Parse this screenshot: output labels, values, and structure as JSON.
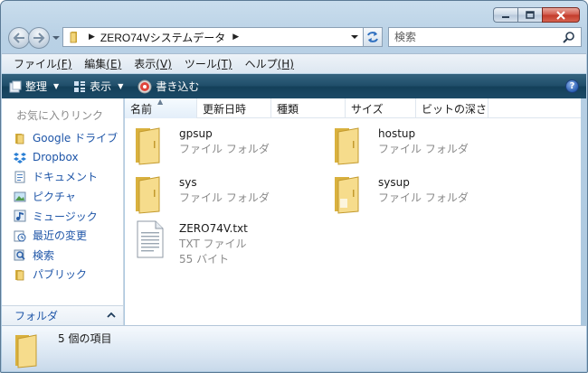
{
  "address": {
    "path": "ZERO74Vシステムデータ"
  },
  "search": {
    "placeholder": "検索"
  },
  "menu": [
    {
      "label": "ファイル",
      "key": "(F)"
    },
    {
      "label": "編集",
      "key": "(E)"
    },
    {
      "label": "表示",
      "key": "(V)"
    },
    {
      "label": "ツール",
      "key": "(T)"
    },
    {
      "label": "ヘルプ",
      "key": "(H)"
    }
  ],
  "toolbar": {
    "organize": "整理",
    "view": "表示",
    "burn": "書き込む",
    "help": "?"
  },
  "nav": {
    "favorites_header": "お気に入りリンク",
    "items": [
      {
        "label": "Google ドライブ",
        "icon": "google-drive-icon"
      },
      {
        "label": "Dropbox",
        "icon": "dropbox-icon"
      },
      {
        "label": "ドキュメント",
        "icon": "documents-icon"
      },
      {
        "label": "ピクチャ",
        "icon": "pictures-icon"
      },
      {
        "label": "ミュージック",
        "icon": "music-icon"
      },
      {
        "label": "最近の変更",
        "icon": "recent-icon"
      },
      {
        "label": "検索",
        "icon": "search-folder-icon"
      },
      {
        "label": "パブリック",
        "icon": "public-folder-icon"
      }
    ],
    "folders_label": "フォルダ"
  },
  "columns": [
    "名前",
    "更新日時",
    "種類",
    "サイズ",
    "ビットの深さ"
  ],
  "files": [
    {
      "name": "gpsup",
      "type": "ファイル フォルダ",
      "kind": "folder"
    },
    {
      "name": "hostup",
      "type": "ファイル フォルダ",
      "kind": "folder"
    },
    {
      "name": "sys",
      "type": "ファイル フォルダ",
      "kind": "folder"
    },
    {
      "name": "sysup",
      "type": "ファイル フォルダ",
      "kind": "folder"
    },
    {
      "name": "ZERO74V.txt",
      "type": "TXT ファイル",
      "size": "55 バイト",
      "kind": "text"
    }
  ],
  "status": {
    "count": "5 個の項目"
  }
}
